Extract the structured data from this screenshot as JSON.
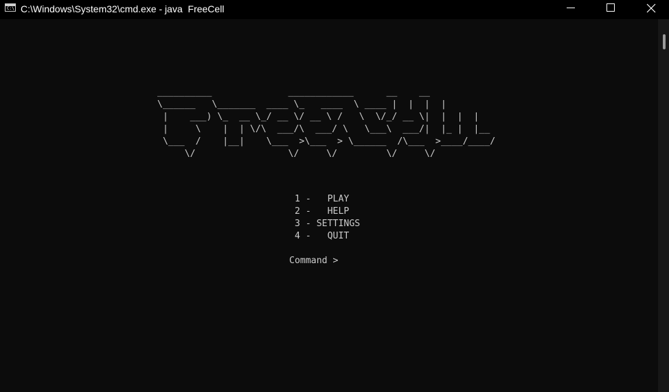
{
  "window": {
    "title": "C:\\Windows\\System32\\cmd.exe - java  FreeCell",
    "icon": "C:\\"
  },
  "console": {
    "logo": "__________              ____________      __    __\n\\______   \\_______  ____ \\_   ____  \\ ____ |  |  |  |\n |    ___) \\_  __ \\_/ __ \\/ __ \\ /   \\  \\/_/ __ \\|  |  |  |\n |     \\    |  | \\/\\  ___/\\  ___/ \\   \\___\\  ___/|  |_ |  |__\n \\___  /    |__|    \\___  >\\___  > \\______  /\\___  >____/____/\n     \\/                 \\/     \\/         \\/     \\/",
    "menu": [
      " 1 -   PLAY",
      " 2 -   HELP",
      " 3 - SETTINGS",
      " 4 -   QUIT"
    ],
    "prompt": "Command > "
  },
  "colors": {
    "background": "#0c0c0c",
    "text": "#cccccc",
    "titlebar": "#000000"
  }
}
